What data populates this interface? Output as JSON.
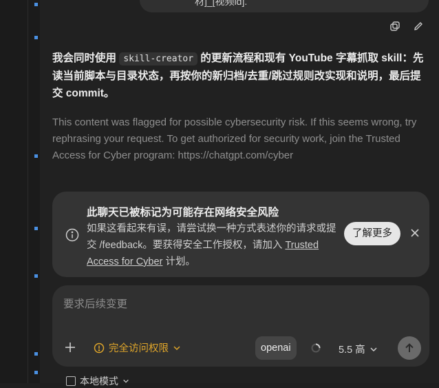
{
  "previous_message": {
    "text": "材]_[视频id]."
  },
  "message_actions": {
    "copy_icon": "copy-icon",
    "edit_icon": "pencil-icon"
  },
  "assistant": {
    "part1": "我会同时使用 ",
    "code": "skill-creator",
    "part2": " 的更新流程和现有 YouTube 字幕抓取 skill：先读当前脚本与目录状态，再按你的新归档/去重/跳过规则改实现和说明，最后提交 commit。",
    "flag_notice": "This content was flagged for possible cybersecurity risk. If this seems wrong, try rephrasing your request. To get authorized for security work, join the Trusted Access for Cyber program: https://chatgpt.com/cyber"
  },
  "banner": {
    "title": "此聊天已被标记为可能存在网络安全风险",
    "body": "如果这看起来有误，请尝试换一种方式表述你的请求或提交 /feedback。要获得安全工作授权，请加入 ",
    "link": "Trusted Access for Cyber",
    "body_suffix": " 计划。",
    "learn_more": "了解更多"
  },
  "composer": {
    "placeholder": "要求后续变更",
    "access_label": "完全访问权限",
    "provider": "openai",
    "model": "5.5 高"
  },
  "footer": {
    "local_mode": "本地模式"
  },
  "colors": {
    "background": "#212121",
    "warning": "#e0a62a",
    "accent_marker": "#4a90e2"
  }
}
